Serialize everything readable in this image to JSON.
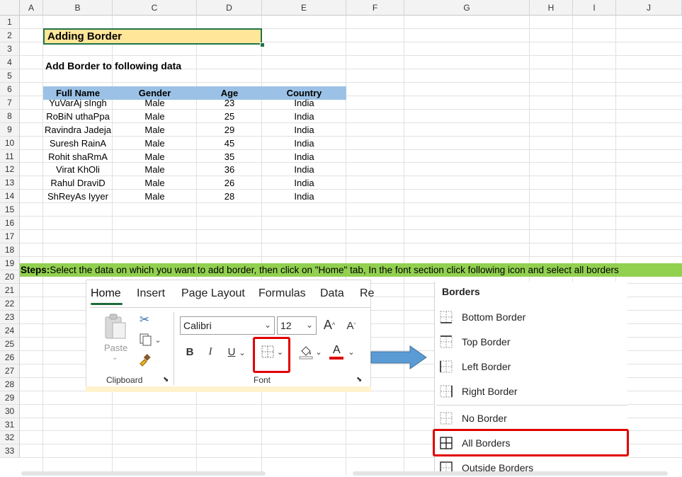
{
  "columns": [
    "A",
    "B",
    "C",
    "D",
    "E",
    "F",
    "G",
    "H",
    "I",
    "J"
  ],
  "rows": [
    "1",
    "2",
    "3",
    "4",
    "5",
    "6",
    "7",
    "8",
    "9",
    "10",
    "11",
    "12",
    "13",
    "14",
    "15",
    "16",
    "17",
    "18",
    "19",
    "20",
    "21",
    "22",
    "23",
    "24",
    "25",
    "26",
    "27",
    "28",
    "29",
    "30",
    "31",
    "32",
    "33"
  ],
  "sheet": {
    "title": "Adding Border",
    "subtitle": "Add Border to following data",
    "table": {
      "headers": [
        "Full Name",
        "Gender",
        "Age",
        "Country"
      ],
      "rows": [
        [
          "YuVarAj sIngh",
          "Male",
          "23",
          "India"
        ],
        [
          "RoBiN uthaPpa",
          "Male",
          "25",
          "India"
        ],
        [
          "Ravindra Jadeja",
          "Male",
          "29",
          "India"
        ],
        [
          "Suresh RainA",
          "Male",
          "45",
          "India"
        ],
        [
          "Rohit shaRmA",
          "Male",
          "35",
          "India"
        ],
        [
          "Virat KhOli",
          "Male",
          "36",
          "India"
        ],
        [
          "Rahul DraviD",
          "Male",
          "26",
          "India"
        ],
        [
          "ShReyAs Iyyer",
          "Male",
          "28",
          "India"
        ]
      ]
    },
    "steps_label": "Steps:",
    "steps_text": " Select the data on which you want to add border, then click on \"Home\" tab, In the font section click following icon and select all borders"
  },
  "ribbon": {
    "tabs": [
      "Home",
      "Insert",
      "Page Layout",
      "Formulas",
      "Data",
      "Re"
    ],
    "paste_label": "Paste",
    "clipboard_label": "Clipboard",
    "font_label": "Font",
    "font_name": "Calibri",
    "font_size": "12",
    "bold": "B",
    "italic": "I",
    "underline": "U",
    "font_color_glyph": "A",
    "grow_font": "A",
    "shrink_font": "A"
  },
  "borders_menu": {
    "title": "Borders",
    "items": [
      "Bottom Border",
      "Top Border",
      "Left Border",
      "Right Border",
      "No Border",
      "All Borders",
      "Outside Borders"
    ]
  },
  "colors": {
    "title_fill": "#ffe699",
    "header_fill": "#9bc2e6",
    "steps_fill": "#92d050",
    "highlight": "#e00000",
    "arrow": "#5b9bd5",
    "excel_green": "#217346"
  }
}
